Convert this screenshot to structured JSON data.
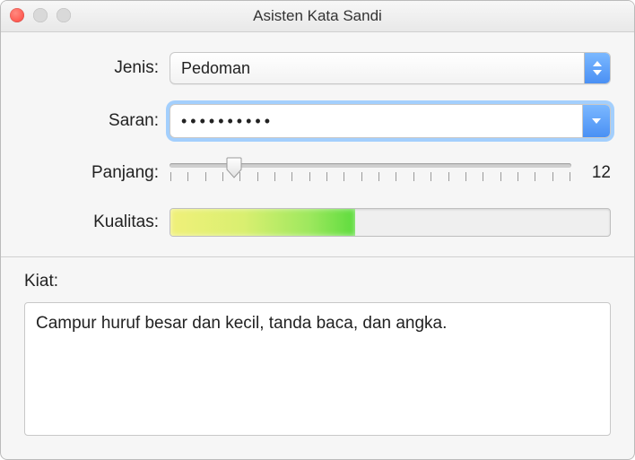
{
  "window": {
    "title": "Asisten Kata Sandi"
  },
  "labels": {
    "type": "Jenis:",
    "suggestion": "Saran:",
    "length": "Panjang:",
    "quality": "Kualitas:",
    "tips": "Kiat:"
  },
  "type": {
    "selected": "Pedoman"
  },
  "suggestion": {
    "masked": "••••••••••"
  },
  "length": {
    "value": "12",
    "min": 8,
    "max": 31,
    "thumb_percent": 16
  },
  "quality": {
    "percent": 42
  },
  "tips": {
    "text": "Campur huruf besar dan kecil, tanda baca, dan angka."
  },
  "icons": {
    "stepper_updown": "stepper-updown-icon",
    "stepper_down": "chevron-down-icon"
  }
}
